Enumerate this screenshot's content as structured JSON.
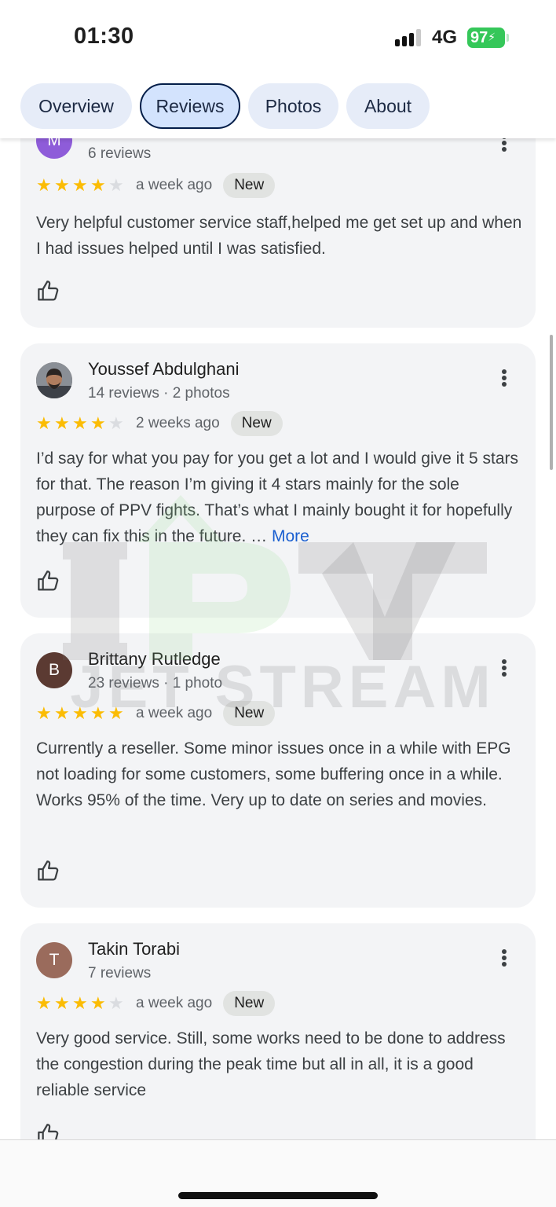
{
  "status_bar": {
    "time": "01:30",
    "network": "4G",
    "battery": "97"
  },
  "tabs": [
    {
      "label": "Overview",
      "active": false
    },
    {
      "label": "Reviews",
      "active": true
    },
    {
      "label": "Photos",
      "active": false
    },
    {
      "label": "About",
      "active": false
    }
  ],
  "reviews": [
    {
      "initial": "M",
      "avatar_color": "#8e5cd9",
      "meta": "6 reviews",
      "rating": 4,
      "time_ago": "a week ago",
      "badge": "New",
      "text": "Very helpful customer service staff,helped me get set up and when I had issues helped until I was satisfied."
    },
    {
      "name": "Youssef Abdulghani",
      "meta": "14 reviews · 2 photos",
      "rating": 4,
      "time_ago": "2 weeks ago",
      "badge": "New",
      "text": "I’d say for what you pay for you get a lot and I would give it 5 stars for that. The reason I’m giving it 4 stars mainly for the sole purpose of PPV fights. That’s what I mainly bought it for hopefully they can fix this in the future. …",
      "more_label": "More"
    },
    {
      "name": "Brittany Rutledge",
      "initial": "B",
      "avatar_color": "#5b3a32",
      "meta": "23 reviews · 1 photo",
      "rating": 5,
      "time_ago": "a week ago",
      "badge": "New",
      "text": "Currently a reseller. Some minor issues once in a while with EPG not loading for some customers, some buffering once in a while. Works 95% of the time. Very up to date on series and movies."
    },
    {
      "name": "Takin Torabi",
      "initial": "T",
      "avatar_color": "#9a6b5c",
      "meta": "7 reviews",
      "rating": 4,
      "time_ago": "a week ago",
      "badge": "New",
      "text": "Very good service. Still, some works need to be done to address the congestion during the peak time but all in all, it is a good reliable service"
    }
  ],
  "watermark": {
    "line1": "IPTV",
    "line2": "JET STREAM"
  },
  "colors": {
    "star": "#fbbc04",
    "star_empty": "#dadce0",
    "link": "#1a5fd0",
    "card_bg": "#f3f4f6",
    "tab_bg": "#e6ecf8",
    "tab_active_bg": "#d3e3fd"
  },
  "icons": [
    "thumb-up-icon",
    "more-vert-icon",
    "star-icon"
  ]
}
